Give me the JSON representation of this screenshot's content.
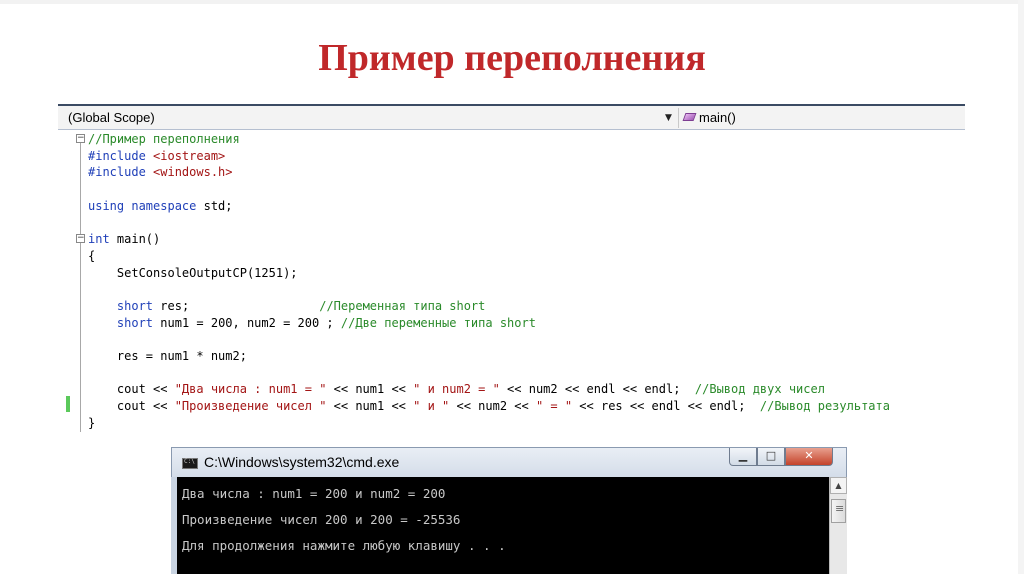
{
  "slide": {
    "title": "Пример переполнения"
  },
  "editor": {
    "scope_left": "(Global Scope)",
    "scope_right": "main()",
    "code_lines": [
      [
        {
          "t": "//Пример переполнения",
          "c": "cm"
        }
      ],
      [
        {
          "t": "#include ",
          "c": "kw"
        },
        {
          "t": "<iostream>",
          "c": "str"
        }
      ],
      [
        {
          "t": "#include ",
          "c": "kw"
        },
        {
          "t": "<windows.h>",
          "c": "str"
        }
      ],
      [],
      [
        {
          "t": "using ",
          "c": "kw"
        },
        {
          "t": "namespace ",
          "c": "kw"
        },
        {
          "t": "std;",
          "c": ""
        }
      ],
      [],
      [
        {
          "t": "int ",
          "c": "kw"
        },
        {
          "t": "main()",
          "c": ""
        }
      ],
      [
        {
          "t": "{",
          "c": ""
        }
      ],
      [
        {
          "t": "    SetConsoleOutputCP(1251);",
          "c": ""
        }
      ],
      [],
      [
        {
          "t": "    ",
          "c": ""
        },
        {
          "t": "short ",
          "c": "kw"
        },
        {
          "t": "res;                  ",
          "c": ""
        },
        {
          "t": "//Переменная типа short",
          "c": "cm"
        }
      ],
      [
        {
          "t": "    ",
          "c": ""
        },
        {
          "t": "short ",
          "c": "kw"
        },
        {
          "t": "num1 = 200, num2 = 200 ; ",
          "c": ""
        },
        {
          "t": "//Две переменные типа short",
          "c": "cm"
        }
      ],
      [],
      [
        {
          "t": "    res = num1 * num2;",
          "c": ""
        }
      ],
      [],
      [
        {
          "t": "    cout << ",
          "c": ""
        },
        {
          "t": "\"Два числа : num1 = \"",
          "c": "str"
        },
        {
          "t": " << num1 << ",
          "c": ""
        },
        {
          "t": "\" и num2 = \"",
          "c": "str"
        },
        {
          "t": " << num2 << endl << endl;  ",
          "c": ""
        },
        {
          "t": "//Вывод двух чисел",
          "c": "cm"
        }
      ],
      [
        {
          "t": "    cout << ",
          "c": ""
        },
        {
          "t": "\"Произведение чисел \"",
          "c": "str"
        },
        {
          "t": " << num1 << ",
          "c": ""
        },
        {
          "t": "\" и \"",
          "c": "str"
        },
        {
          "t": " << num2 << ",
          "c": ""
        },
        {
          "t": "\" = \"",
          "c": "str"
        },
        {
          "t": " << res << endl << endl;  ",
          "c": ""
        },
        {
          "t": "//Вывод результата",
          "c": "cm"
        }
      ],
      [
        {
          "t": "}",
          "c": ""
        }
      ]
    ]
  },
  "console": {
    "title": "C:\\Windows\\system32\\cmd.exe",
    "min_glyph": "▁",
    "max_glyph": "□",
    "close_glyph": "✕",
    "lines": [
      "Два числа : num1 = 200 и num2 = 200",
      "Произведение чисел 200 и 200 = -25536",
      "Для продолжения нажмите любую клавишу . . ."
    ]
  }
}
